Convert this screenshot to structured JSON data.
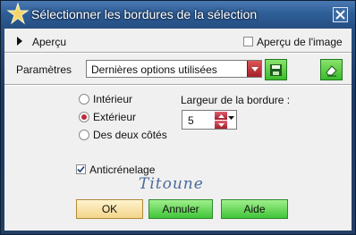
{
  "window": {
    "title": "Sélectionner les bordures de la sélection"
  },
  "preview": {
    "label": "Aperçu",
    "image_preview_label": "Aperçu de l'image"
  },
  "presets": {
    "label": "Paramètres",
    "value": "Dernières options utilisées"
  },
  "inside_outside": {
    "options": [
      {
        "label": "Intérieur",
        "selected": false
      },
      {
        "label": "Extérieur",
        "selected": true
      },
      {
        "label": "Des deux côtés",
        "selected": false
      }
    ]
  },
  "border_width": {
    "label": "Largeur de la bordure :",
    "value": "5"
  },
  "antialias": {
    "label": "Anticrénelage",
    "checked": true
  },
  "watermark": "Titoune",
  "buttons": {
    "ok": "OK",
    "cancel": "Annuler",
    "help": "Aide"
  },
  "colors": {
    "accent_red": "#c0283a",
    "button_green": "#41c43a",
    "title_blue": "#2f5f97"
  }
}
